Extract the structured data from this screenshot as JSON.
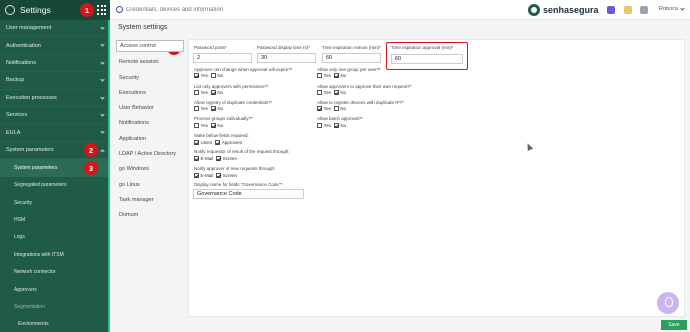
{
  "sidebar": {
    "title": "Settings",
    "items": [
      {
        "label": "User management"
      },
      {
        "label": "Authentication"
      },
      {
        "label": "Notifications"
      },
      {
        "label": "Backup"
      },
      {
        "label": "Execution processes"
      },
      {
        "label": "Services"
      },
      {
        "label": "EULA"
      },
      {
        "label": "System parameters"
      }
    ],
    "sub_items": [
      "System parameters",
      "Segregated parameters",
      "Security",
      "HSM",
      "Logs",
      "Integrations with ITSM",
      "Network connector",
      "Approvers",
      "Segmentation",
      "Environments"
    ]
  },
  "badges": [
    "1",
    "2",
    "3",
    "4"
  ],
  "topbar": {
    "search_placeholder": "Credentials, devices and information",
    "brand": "senhasegura",
    "user": "Roboca"
  },
  "page": {
    "title": "System settings"
  },
  "tabs": [
    "Access control",
    "Remote session",
    "Security",
    "Executions",
    "User Behavior",
    "Notifications",
    "Application",
    "LDAP / Active Directory",
    "go Windows",
    "go Linux",
    "Task manager",
    "Domum"
  ],
  "form": {
    "password_ports": {
      "label": "Password ports*",
      "value": "2"
    },
    "password_display_time": {
      "label": "Password display time (s)*",
      "value": "30"
    },
    "time_expiration_reason": {
      "label": "Time expiration reason (min)*",
      "value": "60"
    },
    "time_expiration_approval": {
      "label": "Time expiration approval (min)*",
      "value": "60"
    },
    "approver_can_change": {
      "label": "Approver can change when approval will expire?*"
    },
    "allow_only_one_group": {
      "label": "Allow only one group per user?*"
    },
    "list_only_approvers": {
      "label": "List only approvers with permission?*"
    },
    "allow_approvers_own": {
      "label": "Allow approvers to approve their own request?*"
    },
    "allow_registry_duplicate": {
      "label": "Allow registry of duplicate credentials?*"
    },
    "allow_register_devices": {
      "label": "Allow to register devices with duplicate IP?*"
    },
    "process_groups": {
      "label": "Process groups individually?*"
    },
    "allow_batch_approval": {
      "label": "Allow batch approval?*"
    },
    "make_below_fields": {
      "label": "Make below fields required:",
      "opt1": "Users",
      "opt2": "Approvers"
    },
    "notify_requestor": {
      "label": "Notify requestor of result of the request through:",
      "opt1": "E-Mail",
      "opt2": "Screen"
    },
    "notify_approver": {
      "label": "Notify approver of new requests through:",
      "opt1": "E-Mail",
      "opt2": "Screen"
    },
    "display_name": {
      "label": "Display name for fields \"Governance Code\"*",
      "value": "Governance Code"
    },
    "yes": "Yes",
    "no": "No"
  },
  "save_label": "Save",
  "colors": {
    "sidebar": "#1f5b46",
    "accent": "#2fbf8a",
    "badge": "#d2161c",
    "save": "#2e9f5b"
  }
}
